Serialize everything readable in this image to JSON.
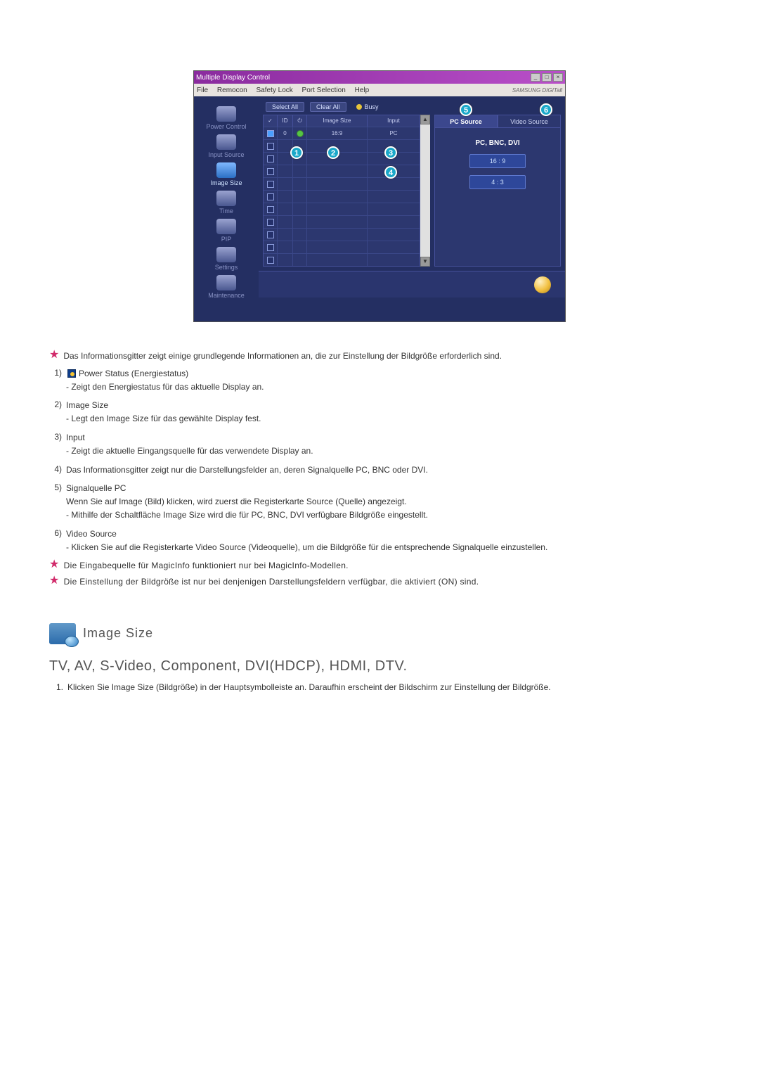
{
  "app": {
    "title": "Multiple Display Control",
    "menu": [
      "File",
      "Remocon",
      "Safety Lock",
      "Port Selection",
      "Help"
    ],
    "brand": "SAMSUNG DIGITall"
  },
  "sidebar": {
    "items": [
      {
        "label": "Power Control",
        "selected": false
      },
      {
        "label": "Input Source",
        "selected": false
      },
      {
        "label": "Image Size",
        "selected": true
      },
      {
        "label": "Time",
        "selected": false
      },
      {
        "label": "PIP",
        "selected": false
      },
      {
        "label": "Settings",
        "selected": false
      },
      {
        "label": "Maintenance",
        "selected": false
      }
    ]
  },
  "toolbar": {
    "select_all": "Select All",
    "clear_all": "Clear All",
    "busy": "Busy"
  },
  "grid": {
    "headers": {
      "id": "ID",
      "image_size": "Image Size",
      "input": "Input"
    },
    "rows": [
      {
        "checked": true,
        "id": "0",
        "power": true,
        "image_size": "16:9",
        "input": "PC"
      },
      {
        "checked": false,
        "id": "",
        "power": false,
        "image_size": "",
        "input": ""
      },
      {
        "checked": false,
        "id": "",
        "power": false,
        "image_size": "",
        "input": ""
      },
      {
        "checked": false,
        "id": "",
        "power": false,
        "image_size": "",
        "input": ""
      },
      {
        "checked": false,
        "id": "",
        "power": false,
        "image_size": "",
        "input": ""
      },
      {
        "checked": false,
        "id": "",
        "power": false,
        "image_size": "",
        "input": ""
      },
      {
        "checked": false,
        "id": "",
        "power": false,
        "image_size": "",
        "input": ""
      },
      {
        "checked": false,
        "id": "",
        "power": false,
        "image_size": "",
        "input": ""
      },
      {
        "checked": false,
        "id": "",
        "power": false,
        "image_size": "",
        "input": ""
      },
      {
        "checked": false,
        "id": "",
        "power": false,
        "image_size": "",
        "input": ""
      },
      {
        "checked": false,
        "id": "",
        "power": false,
        "image_size": "",
        "input": ""
      }
    ]
  },
  "rpanel": {
    "tabs": {
      "pc": "PC Source",
      "video": "Video Source"
    },
    "label": "PC, BNC, DVI",
    "btn_169": "16 : 9",
    "btn_43": "4 : 3"
  },
  "callouts": {
    "c1": "1",
    "c2": "2",
    "c3": "3",
    "c4": "4",
    "c5": "5",
    "c6": "6"
  },
  "doc": {
    "intro": "Das Informationsgitter zeigt einige grundlegende Informationen an, die zur Einstellung der Bildgröße erforderlich sind.",
    "items": [
      {
        "num": "1)",
        "title": "Power Status (Energiestatus)",
        "sub": [
          "Zeigt den Energiestatus für das aktuelle Display an."
        ],
        "hasPwIcon": true
      },
      {
        "num": "2)",
        "title": "Image Size",
        "sub": [
          "Legt den Image Size für das gewählte Display fest."
        ]
      },
      {
        "num": "3)",
        "title": "Input",
        "sub": [
          "Zeigt die aktuelle Eingangsquelle für das verwendete Display an."
        ]
      },
      {
        "num": "4)",
        "title": "Das Informationsgitter zeigt nur die Darstellungsfelder an, deren Signalquelle PC, BNC oder DVI.",
        "sub": []
      },
      {
        "num": "5)",
        "title": "Signalquelle PC",
        "sub": [
          "Wenn Sie auf Image (Bild) klicken, wird zuerst die Registerkarte Source (Quelle) angezeigt.",
          "Mithilfe der Schaltfläche Image Size wird die für PC, BNC, DVI verfügbare Bildgröße eingestellt."
        ],
        "firstSubPlain": true
      },
      {
        "num": "6)",
        "title": "Video Source",
        "sub": [
          "Klicken Sie auf die Registerkarte Video Source (Videoquelle), um die Bildgröße für die entsprechende Signalquelle einzustellen."
        ]
      }
    ],
    "warn1": "Die Eingabequelle für MagicInfo funktioniert nur bei MagicInfo-Modellen.",
    "warn2": "Die Einstellung der Bildgröße ist nur bei denjenigen Darstellungsfeldern verfügbar, die aktiviert (ON) sind."
  },
  "section": {
    "title": "Image Size",
    "subtitle": "TV, AV, S-Video, Component, DVI(HDCP), HDMI, DTV.",
    "step1_no": "1.",
    "step1": "Klicken Sie Image Size (Bildgröße) in der Hauptsymbolleiste an. Daraufhin erscheint der Bildschirm zur Einstellung der Bildgröße."
  }
}
